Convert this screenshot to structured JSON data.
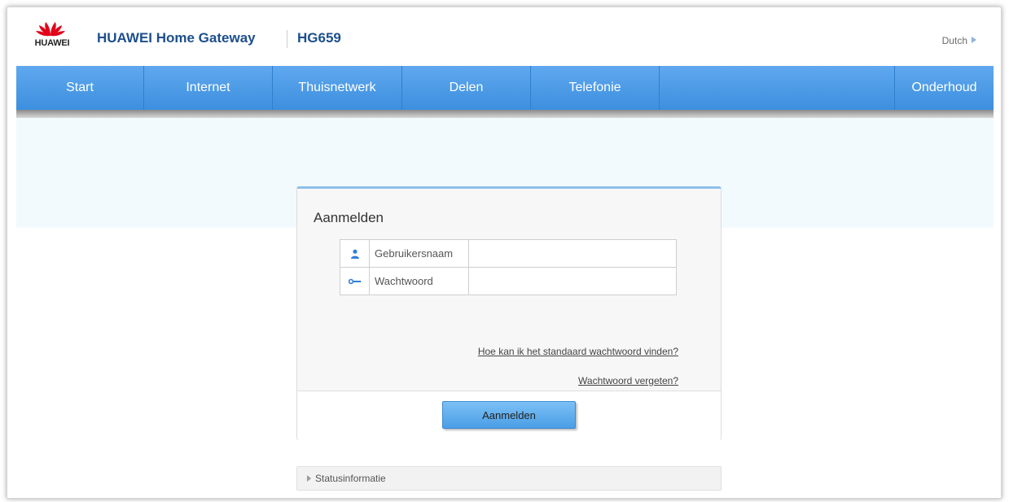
{
  "header": {
    "logo_text": "HUAWEI",
    "title": "HUAWEI Home Gateway",
    "model": "HG659",
    "language": "Dutch"
  },
  "nav": {
    "items": [
      "Start",
      "Internet",
      "Thuisnetwerk",
      "Delen",
      "Telefonie"
    ],
    "right_item": "Onderhoud"
  },
  "login": {
    "title": "Aanmelden",
    "username_label": "Gebruikersnaam",
    "username_value": "",
    "password_label": "Wachtwoord",
    "password_value": "",
    "link_default_password": "Hoe kan ik het standaard wachtwoord vinden?",
    "link_forgot_password": "Wachtwoord vergeten?",
    "submit_label": "Aanmelden"
  },
  "status": {
    "label": "Statusinformatie"
  },
  "icons": {
    "username": "user-icon",
    "password": "key-icon",
    "language_arrow": "triangle-right-icon",
    "status_arrow": "triangle-right-icon"
  },
  "colors": {
    "nav_blue": "#4a9be6",
    "brand_blue": "#1d4f8c",
    "logo_red": "#e2001a"
  }
}
